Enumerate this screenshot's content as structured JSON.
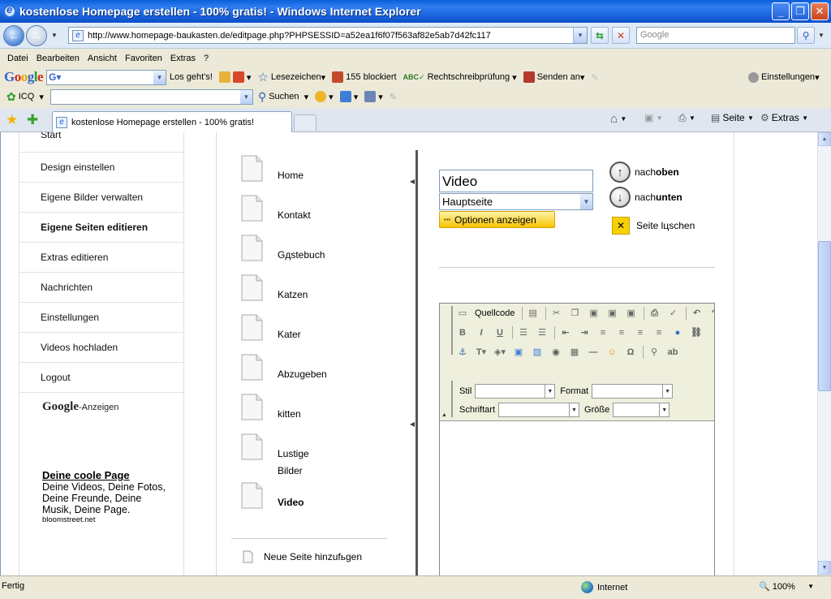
{
  "window": {
    "title": "kostenlose Homepage erstellen - 100% gratis! - Windows Internet Explorer"
  },
  "address": {
    "url": "http://www.homepage-baukasten.de/editpage.php?PHPSESSID=a52ea1f6f07f563af82e5ab7d42fc117",
    "search_placeholder": "Google"
  },
  "menu": [
    "Datei",
    "Bearbeiten",
    "Ansicht",
    "Favoriten",
    "Extras",
    "?"
  ],
  "google_toolbar": {
    "go_label": "Los geht's!",
    "bookmarks_label": "Lesezeichen",
    "blocked_label": "155 blockiert",
    "spellcheck_label": "Rechtschreibprüfung",
    "send_label": "Senden an",
    "settings_label": "Einstellungen"
  },
  "icq_toolbar": {
    "icq_label": "ICQ",
    "search_label": "Suchen"
  },
  "tabs": {
    "active_title": "kostenlose Homepage erstellen - 100% gratis!",
    "page_label": "Seite",
    "extras_label": "Extras"
  },
  "sidebar": {
    "items": [
      {
        "label": "Start"
      },
      {
        "label": "Design einstellen"
      },
      {
        "label": "Eigene Bilder verwalten"
      },
      {
        "label": "Eigene Seiten editieren"
      },
      {
        "label": "Extras editieren"
      },
      {
        "label": "Nachrichten"
      },
      {
        "label": "Einstellungen"
      },
      {
        "label": "Videos hochladen"
      },
      {
        "label": "Logout"
      }
    ],
    "ad": {
      "google_label": "Google",
      "ads_suffix": "-Anzeigen",
      "title": "Deine coole Page",
      "text": "Deine Videos, Deine Fotos, Deine Freunde, Deine Musik, Deine Page.",
      "url": "bloomstreet.net"
    }
  },
  "pages": {
    "items": [
      {
        "label": "Home"
      },
      {
        "label": "Kontakt"
      },
      {
        "label": "Gдstebuch"
      },
      {
        "label": "Katzen"
      },
      {
        "label": "Kater"
      },
      {
        "label": "Abzugeben"
      },
      {
        "label": "kitten"
      },
      {
        "label": "Lustige Bilder"
      },
      {
        "label": "Video"
      }
    ],
    "new_page_label": "Neue Seite hinzufьgen"
  },
  "editor_panel": {
    "title_value": "Video",
    "parent_value": "Hauptseite",
    "options_button": "Optionen anzeigen",
    "move_up_prefix": "nach ",
    "move_up_bold": "oben",
    "move_down_prefix": "nach ",
    "move_down_bold": "unten",
    "delete_label": "Seite lцschen",
    "source_label": "Quellcode",
    "style_label": "Stil",
    "format_label": "Format",
    "font_label": "Schriftart",
    "size_label": "Größe"
  },
  "status": {
    "left": "Fertig",
    "zone": "Internet",
    "zoom": "100%"
  }
}
